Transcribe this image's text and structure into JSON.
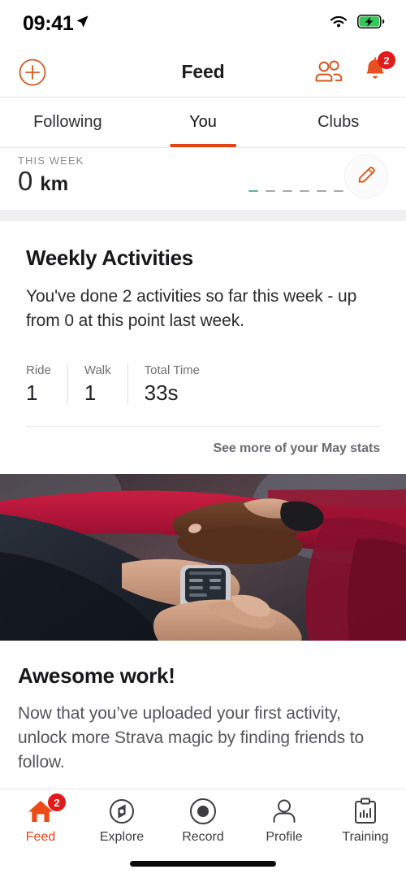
{
  "status_bar": {
    "time": "09:41",
    "location_icon": "location-arrow-icon",
    "wifi_icon": "wifi-icon",
    "battery_icon": "battery-charging-icon",
    "battery_color": "#34c759"
  },
  "header": {
    "title": "Feed",
    "add_icon": "plus-circle-icon",
    "friends_icon": "group-people-icon",
    "notifications_icon": "bell-icon",
    "notifications_count": "2",
    "accent_color": "#e04614",
    "badge_color": "#e01b1b"
  },
  "tabs": [
    {
      "label": "Following",
      "active": false
    },
    {
      "label": "You",
      "active": true
    },
    {
      "label": "Clubs",
      "active": false
    }
  ],
  "this_week": {
    "label": "THIS WEEK",
    "value": "0",
    "unit": "km",
    "edit_icon": "pencil-icon",
    "day_dashes": 7,
    "first_dash_color": "#56b6a5",
    "dash_color": "#a8a8ad"
  },
  "weekly_card": {
    "title": "Weekly Activities",
    "body": "You've done 2 activities so far this week - up from 0 at this point last week.",
    "stats": [
      {
        "label": "Ride",
        "value": "1"
      },
      {
        "label": "Walk",
        "value": "1"
      },
      {
        "label": "Total Time",
        "value": "33s"
      }
    ],
    "see_more": "See more of your May stats"
  },
  "photo": {
    "alt": "hands-with-smartwatch-photo"
  },
  "promo": {
    "title": "Awesome work!",
    "body": "Now that you’ve uploaded your first activity, unlock more Strava magic by finding friends to follow."
  },
  "bottom_nav": [
    {
      "label": "Feed",
      "icon": "home-icon",
      "active": true,
      "badge": "2"
    },
    {
      "label": "Explore",
      "icon": "compass-icon",
      "active": false,
      "badge": ""
    },
    {
      "label": "Record",
      "icon": "record-dot-icon",
      "active": false,
      "badge": ""
    },
    {
      "label": "Profile",
      "icon": "person-icon",
      "active": false,
      "badge": ""
    },
    {
      "label": "Training",
      "icon": "clipboard-chart-icon",
      "active": false,
      "badge": ""
    }
  ]
}
